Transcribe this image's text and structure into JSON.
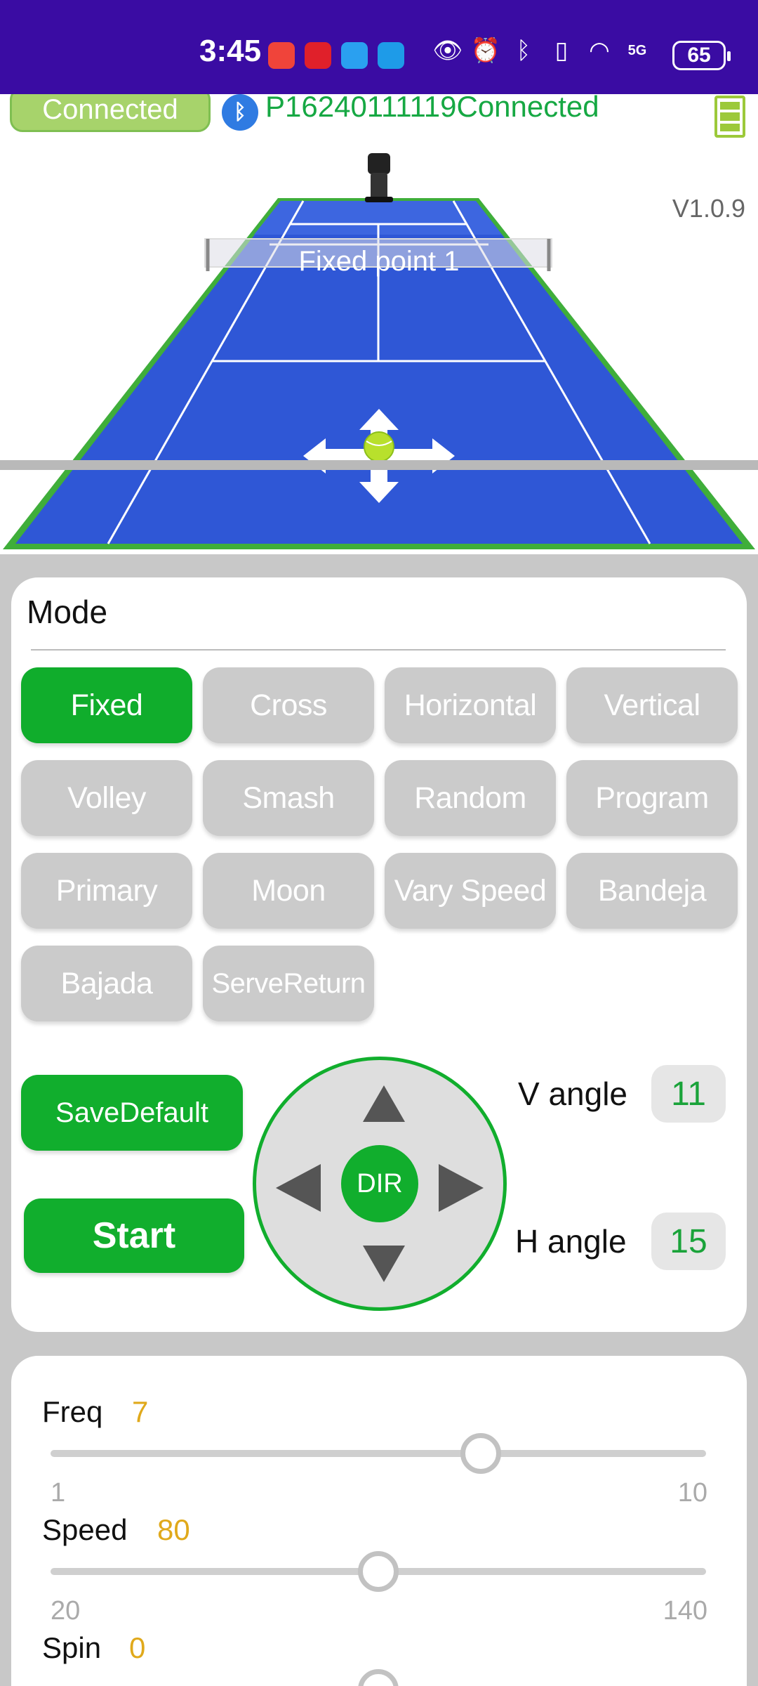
{
  "status_bar": {
    "time": "3:45",
    "battery": "65",
    "network": "5G"
  },
  "header": {
    "connect_button": "Connected",
    "device_status": "P16240111119Connected",
    "version": "V1.0.9"
  },
  "court": {
    "point_label": "Fixed point 1"
  },
  "mode": {
    "title": "Mode",
    "buttons": [
      "Fixed",
      "Cross",
      "Horizontal",
      "Vertical",
      "Volley",
      "Smash",
      "Random",
      "Program",
      "Primary",
      "Moon",
      "Vary Speed",
      "Bandeja",
      "Bajada",
      "ServeReturn"
    ],
    "selected": "Fixed"
  },
  "controls": {
    "save_default": "SaveDefault",
    "start": "Start",
    "dpad_center": "DIR",
    "v_angle_label": "V angle",
    "v_angle_value": "11",
    "h_angle_label": "H angle",
    "h_angle_value": "15"
  },
  "settings": {
    "freq": {
      "label": "Freq",
      "value": "7",
      "min": "1",
      "max": "10",
      "fraction": 0.667
    },
    "speed": {
      "label": "Speed",
      "value": "80",
      "min": "20",
      "max": "140",
      "fraction": 0.5
    },
    "spin": {
      "label": "Spin",
      "value": "0"
    }
  },
  "colors": {
    "accent_green": "#10ad2c",
    "status_bar": "#3a0ca3",
    "court_blue": "#2f57d6",
    "value_yellow": "#e0a91b"
  }
}
